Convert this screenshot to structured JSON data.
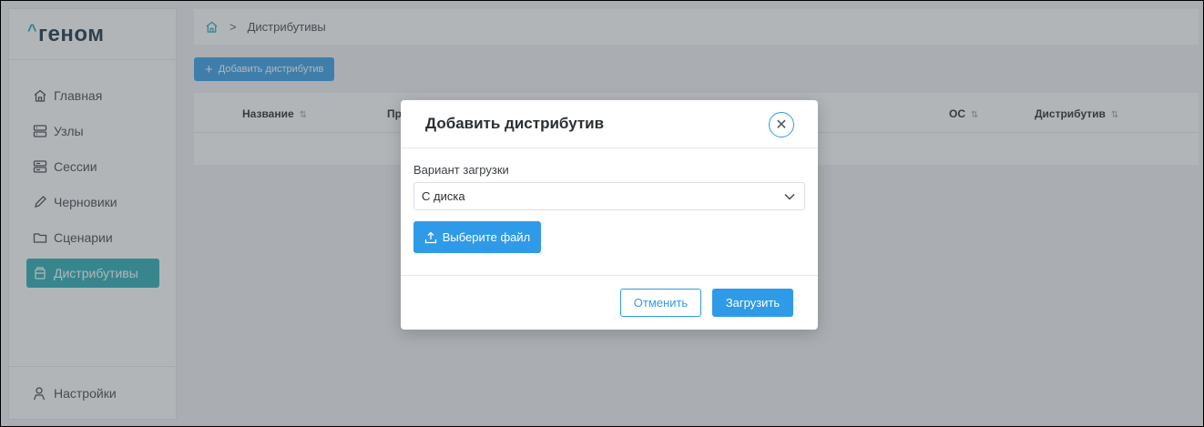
{
  "app": {
    "logo_text": "геном",
    "logo_caret": "^"
  },
  "sidebar": {
    "items": [
      {
        "label": "Главная",
        "icon": "home-icon"
      },
      {
        "label": "Узлы",
        "icon": "server-icon"
      },
      {
        "label": "Сессии",
        "icon": "sessions-icon"
      },
      {
        "label": "Черновики",
        "icon": "pencil-icon"
      },
      {
        "label": "Сценарии",
        "icon": "folder-icon"
      },
      {
        "label": "Дистрибутивы",
        "icon": "package-icon",
        "active": true
      }
    ],
    "settings_label": "Настройки"
  },
  "breadcrumb": {
    "current": "Дистрибутивы",
    "separator": ">"
  },
  "toolbar": {
    "add_label": "Добавить дистрибутив"
  },
  "table": {
    "columns": [
      "Название",
      "Пр",
      "ОС",
      "Дистрибутив"
    ],
    "sort_glyph": "⇅"
  },
  "modal": {
    "title": "Добавить дистрибутив",
    "field_label": "Вариант загрузки",
    "select_value": "С диска",
    "file_button": "Выберите файл",
    "cancel": "Отменить",
    "submit": "Загрузить"
  },
  "colors": {
    "accent": "#2f9be8",
    "active_nav": "#1fa9b2",
    "overlay": "rgba(85,90,98,0.45)"
  }
}
